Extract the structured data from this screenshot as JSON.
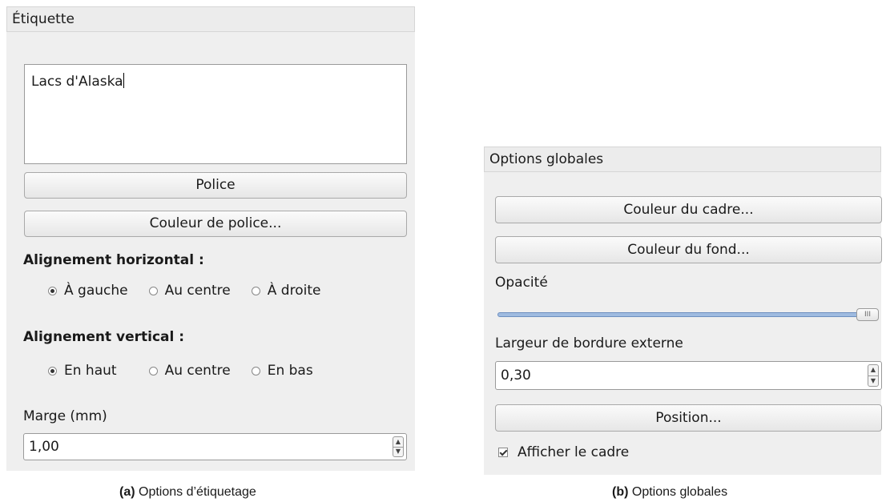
{
  "panel_a": {
    "header": "Étiquette",
    "label_text": "Lacs d'Alaska",
    "font_button": "Police",
    "font_color_button": "Couleur de police...",
    "horizontal_title": "Alignement horizontal :",
    "horizontal_options": [
      "À gauche",
      "Au centre",
      "À droite"
    ],
    "horizontal_selected": "À gauche",
    "vertical_title": "Alignement vertical :",
    "vertical_options": [
      "En haut",
      "Au centre",
      "En bas"
    ],
    "vertical_selected": "En haut",
    "margin_label": "Marge (mm)",
    "margin_value": "1,00"
  },
  "panel_b": {
    "header": "Options globales",
    "frame_color_button": "Couleur du cadre...",
    "bg_color_button": "Couleur du fond...",
    "opacity_label": "Opacité",
    "opacity_value": 1.0,
    "border_width_label": "Largeur de bordure externe",
    "border_width_value": "0,30",
    "position_button": "Position...",
    "show_frame_label": "Afficher le cadre",
    "show_frame_checked": true
  },
  "captions": {
    "a_prefix": "(a)",
    "a_text": "Options d’étiquetage",
    "b_prefix": "(b)",
    "b_text": "Options globales"
  },
  "icons": {
    "radio_selected": "radio-checked-icon",
    "radio_unselected": "radio-unchecked-icon",
    "spin_up": "spin-up-icon",
    "spin_down": "spin-down-icon",
    "checkbox": "checkbox-checked-icon",
    "slider_grip": "slider-grip-icon"
  }
}
